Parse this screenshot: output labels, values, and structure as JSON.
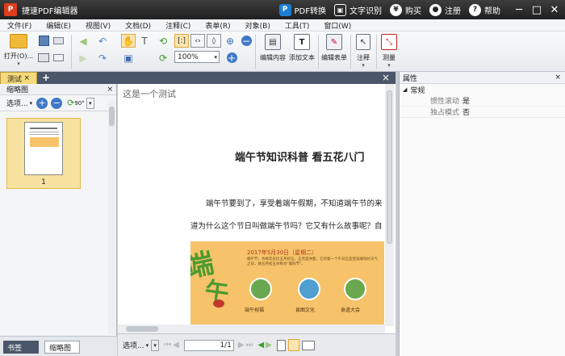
{
  "app": {
    "title": "捷速PDF编辑器",
    "icon": "pdf-logo-icon"
  },
  "title_actions": [
    {
      "label": "PDF转换",
      "icon": "pdf-convert-icon",
      "color": "#1a7fd4"
    },
    {
      "label": "文字识别",
      "icon": "ocr-icon",
      "color": "#ffffff"
    },
    {
      "label": "购买",
      "icon": "buy-icon",
      "color": "#ffffff"
    },
    {
      "label": "注册",
      "icon": "register-icon",
      "color": "#ffffff"
    },
    {
      "label": "帮助",
      "icon": "help-icon",
      "color": "#ffffff"
    }
  ],
  "menu": [
    "文件(F)",
    "编辑(E)",
    "视图(V)",
    "文档(D)",
    "注释(C)",
    "表单(R)",
    "对象(B)",
    "工具(T)",
    "窗口(W)"
  ],
  "toolbar": {
    "open_label": "打开(O)...",
    "zoom_value": "100%",
    "edit_content": "编辑内容",
    "add_text": "添加文本",
    "edit_form": "编辑表单",
    "annotate": "注释",
    "measure": "测量"
  },
  "tabs": {
    "doc_tab": "测试",
    "add_tab": "+",
    "close": "×"
  },
  "left_panel": {
    "title": "缩略图",
    "options": "选项...",
    "rotate": "90°",
    "page_number": "1",
    "bottom_tabs": [
      "书签",
      "缩略图"
    ],
    "active_bottom_tab": "缩略图"
  },
  "document": {
    "header_text": "这是一个测试",
    "heading": "端午节知识科普  看五花八门",
    "para1": "端午节要到了，享受着端午假期，不知道端午节的来",
    "para2": "道为什么这个节日叫做端午节吗？它又有什么故事呢？自",
    "banner": {
      "big_chars_1": "端",
      "big_chars_2": "午",
      "date": "2017年5月30日（星期二）",
      "desc": "端午节，为每年农历五月初五，五月是仲夏，它的第一个午日正是登高顺阳好天气之日，故五月初五亦称为\"端阳节\"。",
      "circles": [
        "端午祝福",
        "县图文化",
        "食道大会"
      ],
      "bg_color": "#f6c36a"
    }
  },
  "nav": {
    "options": "选项...",
    "page_current": "1",
    "page_total": "/1"
  },
  "right_panel": {
    "title": "属性",
    "section": "常规",
    "props": [
      {
        "name": "惯性滚动",
        "value": "是"
      },
      {
        "name": "独占模式",
        "value": "否"
      }
    ]
  }
}
